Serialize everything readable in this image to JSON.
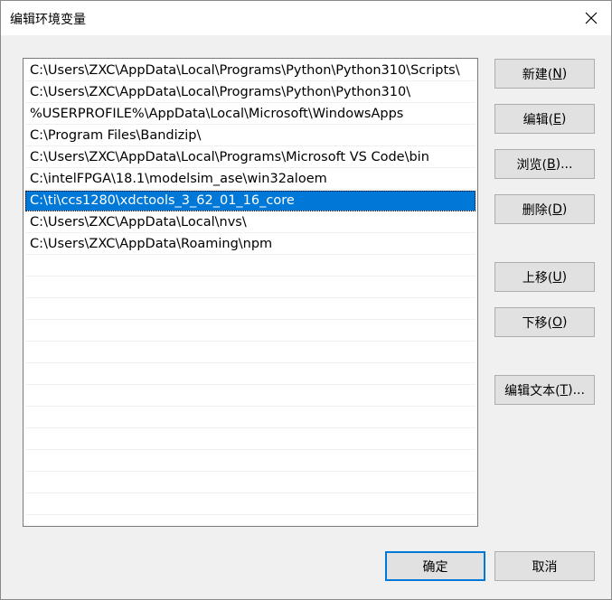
{
  "window": {
    "title": "编辑环境变量"
  },
  "paths": [
    {
      "value": "C:\\Users\\ZXC\\AppData\\Local\\Programs\\Python\\Python310\\Scripts\\",
      "selected": false
    },
    {
      "value": "C:\\Users\\ZXC\\AppData\\Local\\Programs\\Python\\Python310\\",
      "selected": false
    },
    {
      "value": "%USERPROFILE%\\AppData\\Local\\Microsoft\\WindowsApps",
      "selected": false
    },
    {
      "value": "C:\\Program Files\\Bandizip\\",
      "selected": false
    },
    {
      "value": "C:\\Users\\ZXC\\AppData\\Local\\Programs\\Microsoft VS Code\\bin",
      "selected": false
    },
    {
      "value": "C:\\intelFPGA\\18.1\\modelsim_ase\\win32aloem",
      "selected": false
    },
    {
      "value": "C:\\ti\\ccs1280\\xdctools_3_62_01_16_core",
      "selected": true
    },
    {
      "value": "C:\\Users\\ZXC\\AppData\\Local\\nvs\\",
      "selected": false
    },
    {
      "value": "C:\\Users\\ZXC\\AppData\\Roaming\\npm",
      "selected": false
    }
  ],
  "buttons": {
    "new": {
      "label": "新建(",
      "accel": "N",
      "suffix": ")"
    },
    "edit": {
      "label": "编辑(",
      "accel": "E",
      "suffix": ")"
    },
    "browse": {
      "label": "浏览(",
      "accel": "B",
      "suffix": ")..."
    },
    "delete": {
      "label": "删除(",
      "accel": "D",
      "suffix": ")"
    },
    "move_up": {
      "label": "上移(",
      "accel": "U",
      "suffix": ")"
    },
    "move_down": {
      "label": "下移(",
      "accel": "O",
      "suffix": ")"
    },
    "edit_text": {
      "label": "编辑文本(",
      "accel": "T",
      "suffix": ")..."
    },
    "ok": {
      "label": "确定"
    },
    "cancel": {
      "label": "取消"
    }
  },
  "colors": {
    "selection": "#0078d7",
    "dialog_bg": "#f0f0f0",
    "button_bg": "#e1e1e1"
  },
  "icons": {
    "close": "close-icon"
  }
}
